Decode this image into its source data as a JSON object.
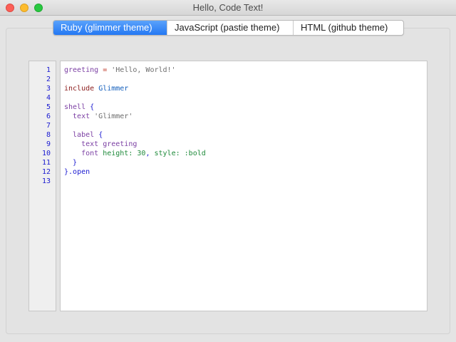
{
  "window": {
    "title": "Hello, Code Text!"
  },
  "tabs": [
    {
      "label": "Ruby (glimmer theme)",
      "active": true
    },
    {
      "label": "JavaScript (pastie theme)",
      "active": false
    },
    {
      "label": "HTML (github theme)",
      "active": false
    }
  ],
  "colors": {
    "active_tab": "#2f80f6",
    "line_numbers": "#1a1ad1",
    "editor_background": "#ffffff"
  },
  "editor": {
    "line_numbers": [
      "1",
      "2",
      "3",
      "4",
      "5",
      "6",
      "7",
      "8",
      "9",
      "10",
      "11",
      "12",
      "13"
    ],
    "lines": [
      [
        {
          "t": "greeting",
          "c": "ident"
        },
        {
          "t": " ",
          "c": ""
        },
        {
          "t": "=",
          "c": "op"
        },
        {
          "t": " ",
          "c": ""
        },
        {
          "t": "'Hello, World!'",
          "c": "str"
        }
      ],
      [],
      [
        {
          "t": "include",
          "c": "kw"
        },
        {
          "t": " ",
          "c": ""
        },
        {
          "t": "Glimmer",
          "c": "const"
        }
      ],
      [],
      [
        {
          "t": "shell",
          "c": "meth"
        },
        {
          "t": " ",
          "c": ""
        },
        {
          "t": "{",
          "c": "punct"
        }
      ],
      [
        {
          "t": "  text",
          "c": "meth"
        },
        {
          "t": " ",
          "c": ""
        },
        {
          "t": "'Glimmer'",
          "c": "str"
        }
      ],
      [],
      [
        {
          "t": "  label",
          "c": "meth"
        },
        {
          "t": " ",
          "c": ""
        },
        {
          "t": "{",
          "c": "punct"
        }
      ],
      [
        {
          "t": "    text",
          "c": "meth"
        },
        {
          "t": " ",
          "c": ""
        },
        {
          "t": "greeting",
          "c": "ident"
        }
      ],
      [
        {
          "t": "    font",
          "c": "meth"
        },
        {
          "t": " ",
          "c": ""
        },
        {
          "t": "height:",
          "c": "sym"
        },
        {
          "t": " ",
          "c": ""
        },
        {
          "t": "30",
          "c": "num"
        },
        {
          "t": ",",
          "c": "punct"
        },
        {
          "t": " ",
          "c": ""
        },
        {
          "t": "style:",
          "c": "sym"
        },
        {
          "t": " ",
          "c": ""
        },
        {
          "t": ":bold",
          "c": "sym"
        }
      ],
      [
        {
          "t": "  }",
          "c": "punct"
        }
      ],
      [
        {
          "t": "}",
          "c": "punct"
        },
        {
          "t": ".open",
          "c": "punct"
        }
      ],
      []
    ]
  }
}
